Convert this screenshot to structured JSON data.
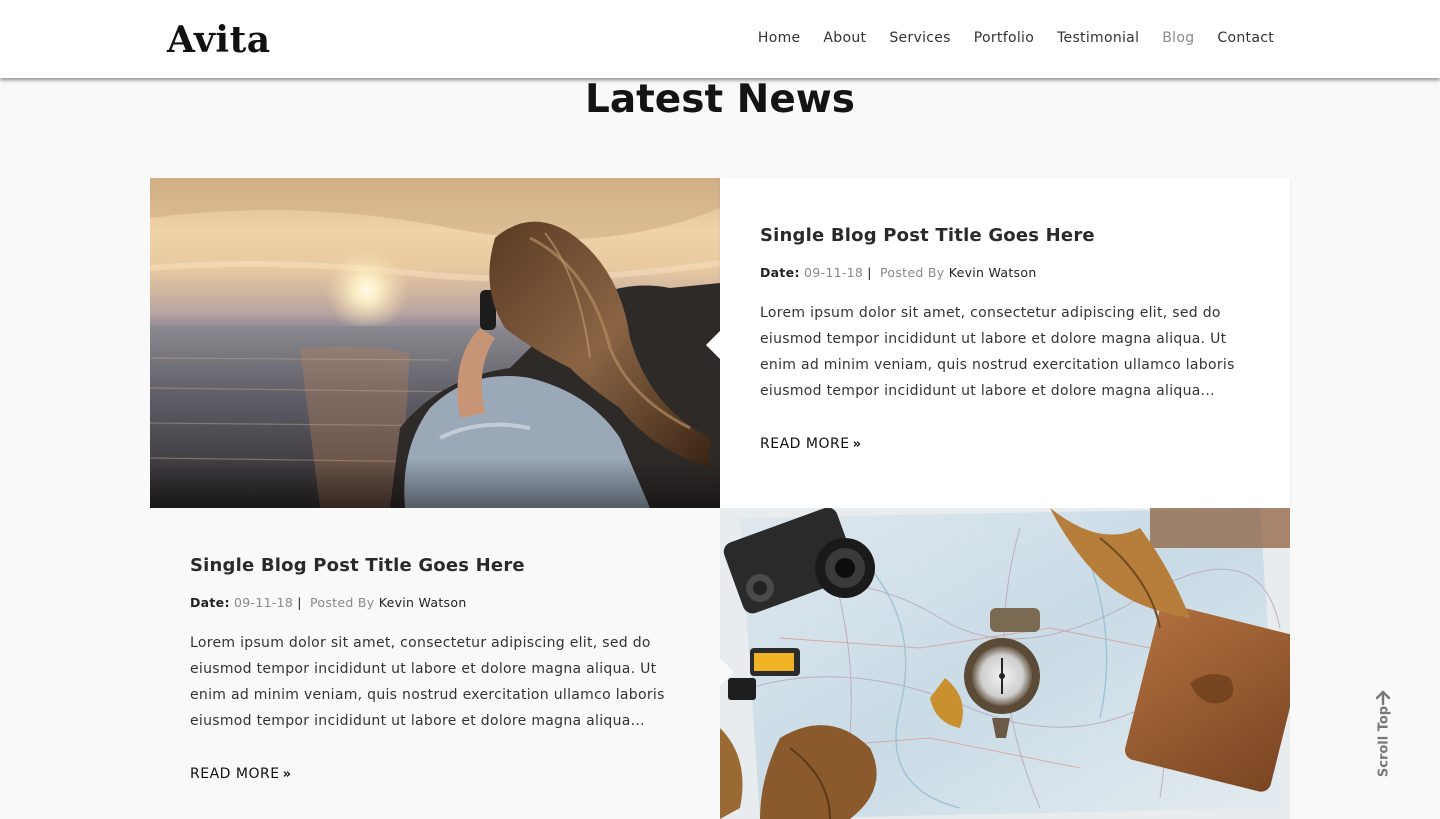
{
  "header": {
    "logo": "Avita",
    "nav": [
      {
        "label": "Home",
        "active": false
      },
      {
        "label": "About",
        "active": false
      },
      {
        "label": "Services",
        "active": false
      },
      {
        "label": "Portfolio",
        "active": false
      },
      {
        "label": "Testimonial",
        "active": false
      },
      {
        "label": "Blog",
        "active": true
      },
      {
        "label": "Contact",
        "active": false
      }
    ]
  },
  "section": {
    "title": "Latest News"
  },
  "posts": [
    {
      "title": "Single Blog Post Title Goes Here",
      "date_label": "Date:",
      "date": "09-11-18",
      "posted_by_label": "Posted By",
      "author": "Kevin Watson",
      "excerpt": "Lorem ipsum dolor sit amet, consectetur adipiscing elit, sed do eiusmod tempor incididunt ut labore et dolore magna aliqua. Ut enim ad minim veniam, quis nostrud exercitation ullamco laboris eiusmod tempor incididunt ut labore et dolore magna aliqua...",
      "read_more": "READ MORE",
      "image": "woman-sunset-sea-photo"
    },
    {
      "title": "Single Blog Post Title Goes Here",
      "date_label": "Date:",
      "date": "09-11-18",
      "posted_by_label": "Posted By",
      "author": "Kevin Watson",
      "excerpt": "Lorem ipsum dolor sit amet, consectetur adipiscing elit, sed do eiusmod tempor incididunt ut labore et dolore magna aliqua. Ut enim ad minim veniam, quis nostrud exercitation ullamco laboris eiusmod tempor incididunt ut labore et dolore magna aliqua...",
      "read_more": "READ MORE",
      "image": "travel-map-compass-camera-photo"
    }
  ],
  "scroll_top": {
    "label": "Scroll Top",
    "icon": "arrow-up-icon"
  },
  "colors": {
    "background": "#f9f9f9",
    "card": "#ffffff",
    "text": "#222222",
    "muted": "#888888",
    "nav_active": "#8a8a8a"
  }
}
